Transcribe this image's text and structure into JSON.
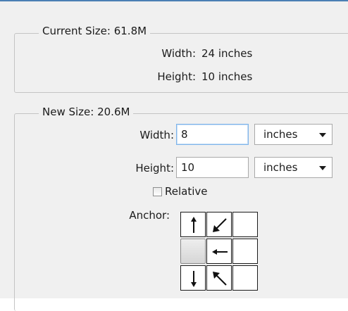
{
  "current_size": {
    "legend": "Current Size: 61.8M",
    "width_label": "Width:",
    "width_value": "24 inches",
    "height_label": "Height:",
    "height_value": "10 inches"
  },
  "new_size": {
    "legend": "New Size: 20.6M",
    "width_label": "Width:",
    "width_value": "8",
    "width_unit": "inches",
    "height_label": "Height:",
    "height_value": "10",
    "height_unit": "inches",
    "relative_label": "Relative",
    "relative_checked": false,
    "anchor_label": "Anchor:",
    "anchor_selected": "middle-left",
    "anchor_arrows": [
      "arrow-up-icon",
      "arrow-up-right-icon",
      "",
      "",
      "",
      "arrow-left-icon",
      "",
      "arrow-down-icon",
      "arrow-down-right-icon",
      ""
    ]
  },
  "colors": {
    "accent": "#4b7fb4",
    "focus_border": "#7eb4ea",
    "group_border": "#c4c4c4"
  }
}
